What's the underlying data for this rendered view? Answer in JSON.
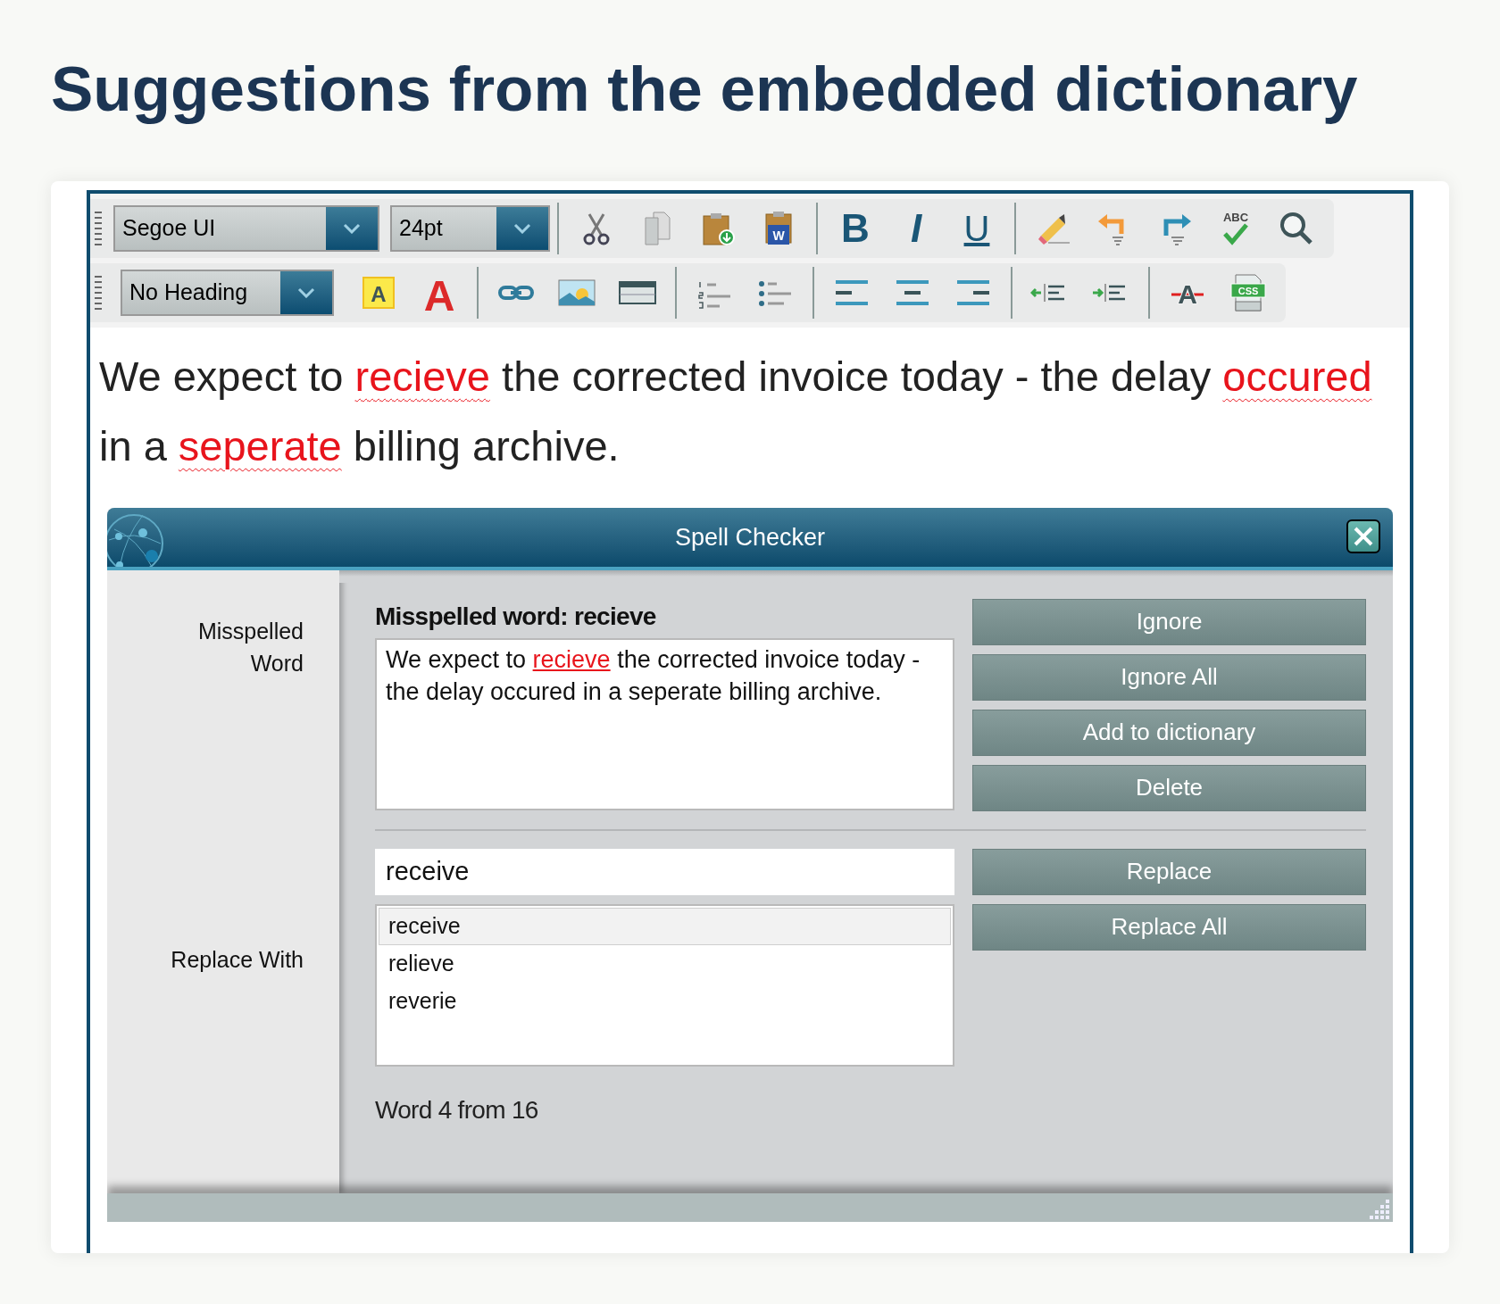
{
  "heading": "Suggestions from the embedded dictionary",
  "toolbar": {
    "rows": [
      {
        "items": [
          {
            "kind": "grip"
          },
          {
            "kind": "font-select",
            "value": "Segoe UI"
          },
          {
            "kind": "size-select",
            "value": "24pt"
          },
          {
            "kind": "separator"
          },
          {
            "kind": "cut"
          },
          {
            "kind": "copy"
          },
          {
            "kind": "paste"
          },
          {
            "kind": "paste-word",
            "text": "W"
          },
          {
            "kind": "separator"
          },
          {
            "kind": "bold",
            "text": "B"
          },
          {
            "kind": "italic",
            "text": "I"
          },
          {
            "kind": "underline",
            "text": "U"
          },
          {
            "kind": "separator"
          },
          {
            "kind": "eraser"
          },
          {
            "kind": "undo"
          },
          {
            "kind": "redo"
          },
          {
            "kind": "spellcheck",
            "text": "ABC"
          },
          {
            "kind": "find"
          }
        ]
      },
      {
        "items": [
          {
            "kind": "grip"
          },
          {
            "kind": "heading-select",
            "value": "No Heading"
          },
          {
            "kind": "highlight",
            "text": "A"
          },
          {
            "kind": "font-color",
            "text": "A"
          },
          {
            "kind": "separator"
          },
          {
            "kind": "link"
          },
          {
            "kind": "image"
          },
          {
            "kind": "table"
          },
          {
            "kind": "separator"
          },
          {
            "kind": "numbered-list"
          },
          {
            "kind": "bullet-list"
          },
          {
            "kind": "separator"
          },
          {
            "kind": "align-left"
          },
          {
            "kind": "align-center"
          },
          {
            "kind": "align-right"
          },
          {
            "kind": "separator"
          },
          {
            "kind": "outdent"
          },
          {
            "kind": "indent"
          },
          {
            "kind": "separator"
          },
          {
            "kind": "strikethrough",
            "text": "A"
          },
          {
            "kind": "css",
            "text": "CSS"
          }
        ]
      }
    ]
  },
  "editor": {
    "segments": [
      {
        "text": "We expect to ",
        "misspelled": false
      },
      {
        "text": "recieve",
        "misspelled": true
      },
      {
        "text": " the corrected invoice today - the delay ",
        "misspelled": false
      },
      {
        "text": "occured",
        "misspelled": true
      },
      {
        "text": " in a ",
        "misspelled": false
      },
      {
        "text": "seperate",
        "misspelled": true
      },
      {
        "text": " billing archive.",
        "misspelled": false
      }
    ]
  },
  "dialog": {
    "title": "Spell Checker",
    "labels": {
      "misspelled": "Misspelled Word",
      "replace": "Replace With"
    },
    "misspelled_heading": "Misspelled word: recieve",
    "context": [
      {
        "text": "We expect to ",
        "current": false
      },
      {
        "text": "recieve",
        "current": true
      },
      {
        "text": " the corrected invoice today - the delay occured in a seperate billing archive.",
        "current": false
      }
    ],
    "top_buttons": [
      "Ignore",
      "Ignore All",
      "Add to dictionary",
      "Delete"
    ],
    "replace_value": "receive",
    "suggestions": [
      {
        "text": "receive",
        "selected": true
      },
      {
        "text": "relieve",
        "selected": false
      },
      {
        "text": "reverie",
        "selected": false
      }
    ],
    "replace_buttons": [
      "Replace",
      "Replace All"
    ],
    "status": "Word 4 from 16"
  }
}
